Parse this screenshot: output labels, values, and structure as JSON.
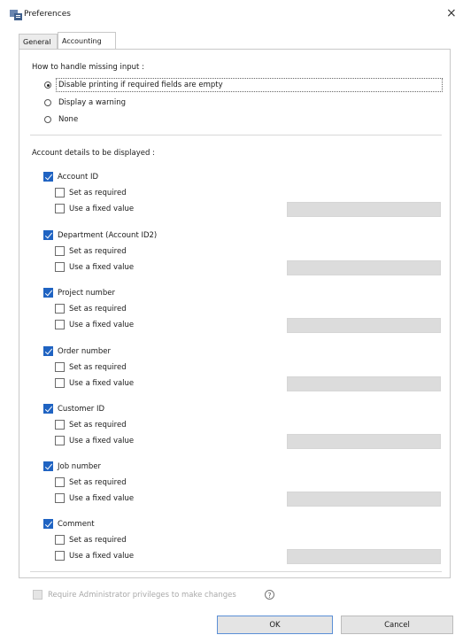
{
  "window": {
    "title": "Preferences",
    "close_symbol": "×"
  },
  "tabs": [
    {
      "label": "General",
      "active": false
    },
    {
      "label": "Accounting",
      "active": true
    }
  ],
  "missing_input": {
    "heading": "How to handle missing input :",
    "options": [
      {
        "label": "Disable printing if required fields are empty",
        "selected": true
      },
      {
        "label": "Display a warning",
        "selected": false
      },
      {
        "label": "None",
        "selected": false
      }
    ]
  },
  "account_details": {
    "heading": "Account details to be displayed :",
    "fields": [
      {
        "label": "Account ID",
        "checked": true,
        "set_required": "Set as required",
        "fixed_value": "Use a fixed value",
        "fixed_input": ""
      },
      {
        "label": "Department (Account ID2)",
        "checked": true,
        "set_required": "Set as required",
        "fixed_value": "Use a fixed value",
        "fixed_input": ""
      },
      {
        "label": "Project number",
        "checked": true,
        "set_required": "Set as required",
        "fixed_value": "Use a fixed value",
        "fixed_input": ""
      },
      {
        "label": "Order number",
        "checked": true,
        "set_required": "Set as required",
        "fixed_value": "Use a fixed value",
        "fixed_input": ""
      },
      {
        "label": "Customer ID",
        "checked": true,
        "set_required": "Set as required",
        "fixed_value": "Use a fixed value",
        "fixed_input": ""
      },
      {
        "label": "Job number",
        "checked": true,
        "set_required": "Set as required",
        "fixed_value": "Use a fixed value",
        "fixed_input": ""
      },
      {
        "label": "Comment",
        "checked": true,
        "set_required": "Set as required",
        "fixed_value": "Use a fixed value",
        "fixed_input": ""
      }
    ]
  },
  "admin": {
    "label": "Require Administrator privileges to make changes",
    "checked": false,
    "enabled": false,
    "help_symbol": "?"
  },
  "buttons": {
    "ok": "OK",
    "cancel": "Cancel"
  },
  "colors": {
    "checkbox_checked": "#1f63c2",
    "default_button_border": "#5b8fd6",
    "disabled_field": "#dcdcdc"
  },
  "icons": {
    "window": "preferences-app-icon",
    "close": "close-icon",
    "help": "help-icon"
  }
}
